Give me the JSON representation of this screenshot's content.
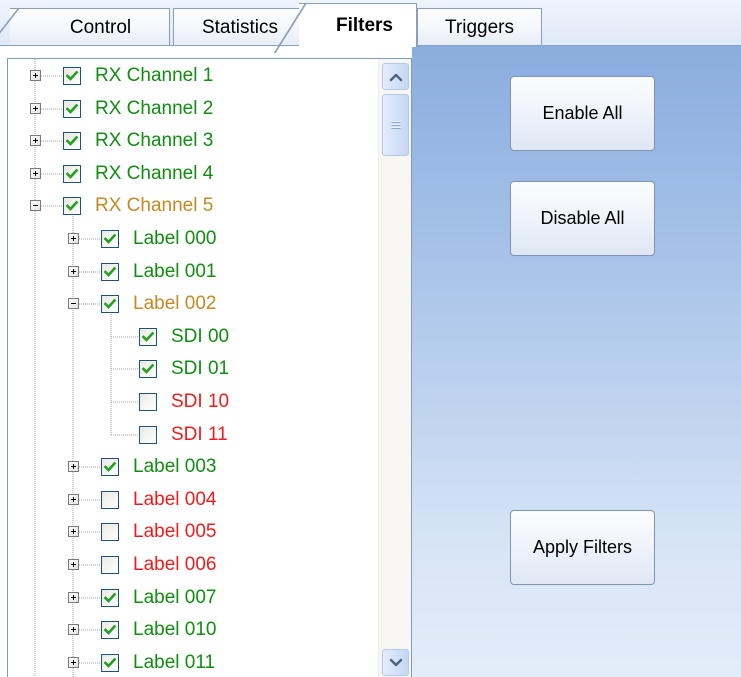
{
  "tabs": [
    {
      "label": "Control"
    },
    {
      "label": "Statistics"
    },
    {
      "label": "Filters",
      "selected": true
    },
    {
      "label": "Triggers"
    }
  ],
  "colors": {
    "enabled": "#118d11",
    "partial": "#c28a22",
    "disabled": "#ee1c1c",
    "tab_border": "#8a9fbd",
    "panel_gradient_top": "#8aaddf",
    "panel_gradient_bottom": "#e3ecf8"
  },
  "tree": [
    {
      "label": "RX Channel 1",
      "level": 0,
      "expander": "plus",
      "checked": true,
      "state": "enabled"
    },
    {
      "label": "RX Channel 2",
      "level": 0,
      "expander": "plus",
      "checked": true,
      "state": "enabled"
    },
    {
      "label": "RX Channel 3",
      "level": 0,
      "expander": "plus",
      "checked": true,
      "state": "enabled"
    },
    {
      "label": "RX Channel 4",
      "level": 0,
      "expander": "plus",
      "checked": true,
      "state": "enabled"
    },
    {
      "label": "RX Channel 5",
      "level": 0,
      "expander": "minus",
      "checked": true,
      "state": "partial"
    },
    {
      "label": "Label 000",
      "level": 1,
      "expander": "plus",
      "checked": true,
      "state": "enabled"
    },
    {
      "label": "Label 001",
      "level": 1,
      "expander": "plus",
      "checked": true,
      "state": "enabled"
    },
    {
      "label": "Label 002",
      "level": 1,
      "expander": "minus",
      "checked": true,
      "state": "partial"
    },
    {
      "label": "SDI 00",
      "level": 2,
      "expander": "none",
      "checked": true,
      "state": "enabled"
    },
    {
      "label": "SDI 01",
      "level": 2,
      "expander": "none",
      "checked": true,
      "state": "enabled"
    },
    {
      "label": "SDI 10",
      "level": 2,
      "expander": "none",
      "checked": false,
      "state": "disabled"
    },
    {
      "label": "SDI 11",
      "level": 2,
      "expander": "none",
      "checked": false,
      "state": "disabled"
    },
    {
      "label": "Label 003",
      "level": 1,
      "expander": "plus",
      "checked": true,
      "state": "enabled"
    },
    {
      "label": "Label 004",
      "level": 1,
      "expander": "plus",
      "checked": false,
      "state": "disabled"
    },
    {
      "label": "Label 005",
      "level": 1,
      "expander": "plus",
      "checked": false,
      "state": "disabled"
    },
    {
      "label": "Label 006",
      "level": 1,
      "expander": "plus",
      "checked": false,
      "state": "disabled"
    },
    {
      "label": "Label 007",
      "level": 1,
      "expander": "plus",
      "checked": true,
      "state": "enabled"
    },
    {
      "label": "Label 010",
      "level": 1,
      "expander": "plus",
      "checked": true,
      "state": "enabled"
    },
    {
      "label": "Label 011",
      "level": 1,
      "expander": "plus",
      "checked": true,
      "state": "enabled"
    }
  ],
  "scrollbar": {
    "up_icon": "chevron-up-icon",
    "down_icon": "chevron-down-icon",
    "thumb_icon": "grip-icon"
  },
  "buttons": {
    "enable_all": "Enable All",
    "disable_all": "Disable All",
    "apply_filters": "Apply Filters"
  }
}
